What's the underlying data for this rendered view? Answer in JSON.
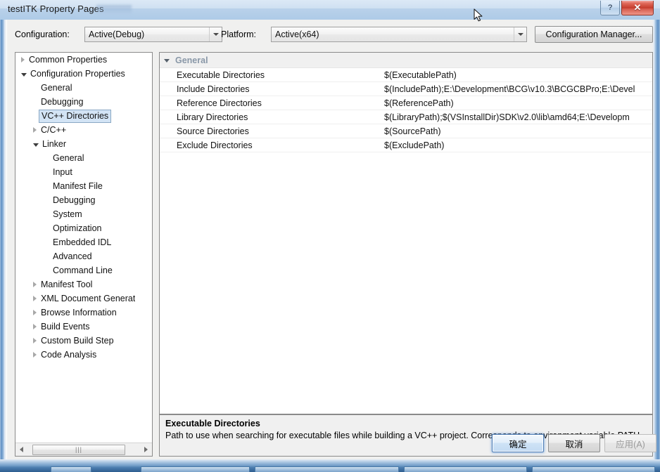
{
  "window": {
    "title": "testITK Property Pages",
    "help_button": "?",
    "close_button": "✕"
  },
  "config_bar": {
    "configuration_label": "Configuration:",
    "configuration_value": "Active(Debug)",
    "platform_label": "Platform:",
    "platform_value": "Active(x64)",
    "configuration_manager_button": "Configuration Manager..."
  },
  "tree": {
    "items": [
      {
        "label": "Common Properties",
        "indent": 0,
        "twisty": "collapsed",
        "selected": false
      },
      {
        "label": "Configuration Properties",
        "indent": 0,
        "twisty": "expanded",
        "selected": false
      },
      {
        "label": "General",
        "indent": 1,
        "twisty": "none",
        "selected": false
      },
      {
        "label": "Debugging",
        "indent": 1,
        "twisty": "none",
        "selected": false
      },
      {
        "label": "VC++ Directories",
        "indent": 1,
        "twisty": "none",
        "selected": true
      },
      {
        "label": "C/C++",
        "indent": 1,
        "twisty": "collapsed",
        "selected": false
      },
      {
        "label": "Linker",
        "indent": 1,
        "twisty": "expanded",
        "selected": false
      },
      {
        "label": "General",
        "indent": 2,
        "twisty": "none",
        "selected": false
      },
      {
        "label": "Input",
        "indent": 2,
        "twisty": "none",
        "selected": false
      },
      {
        "label": "Manifest File",
        "indent": 2,
        "twisty": "none",
        "selected": false
      },
      {
        "label": "Debugging",
        "indent": 2,
        "twisty": "none",
        "selected": false
      },
      {
        "label": "System",
        "indent": 2,
        "twisty": "none",
        "selected": false
      },
      {
        "label": "Optimization",
        "indent": 2,
        "twisty": "none",
        "selected": false
      },
      {
        "label": "Embedded IDL",
        "indent": 2,
        "twisty": "none",
        "selected": false
      },
      {
        "label": "Advanced",
        "indent": 2,
        "twisty": "none",
        "selected": false
      },
      {
        "label": "Command Line",
        "indent": 2,
        "twisty": "none",
        "selected": false
      },
      {
        "label": "Manifest Tool",
        "indent": 1,
        "twisty": "collapsed",
        "selected": false
      },
      {
        "label": "XML Document Generat",
        "indent": 1,
        "twisty": "collapsed",
        "selected": false
      },
      {
        "label": "Browse Information",
        "indent": 1,
        "twisty": "collapsed",
        "selected": false
      },
      {
        "label": "Build Events",
        "indent": 1,
        "twisty": "collapsed",
        "selected": false
      },
      {
        "label": "Custom Build Step",
        "indent": 1,
        "twisty": "collapsed",
        "selected": false
      },
      {
        "label": "Code Analysis",
        "indent": 1,
        "twisty": "collapsed",
        "selected": false
      }
    ],
    "hscroll_grip": "|||"
  },
  "grid": {
    "category": "General",
    "rows": [
      {
        "name": "Executable Directories",
        "value": "$(ExecutablePath)"
      },
      {
        "name": "Include Directories",
        "value": "$(IncludePath);E:\\Development\\BCG\\v10.3\\BCGCBPro;E:\\Devel"
      },
      {
        "name": "Reference Directories",
        "value": "$(ReferencePath)"
      },
      {
        "name": "Library Directories",
        "value": "$(LibraryPath);$(VSInstallDir)SDK\\v2.0\\lib\\amd64;E:\\Developm"
      },
      {
        "name": "Source Directories",
        "value": "$(SourcePath)"
      },
      {
        "name": "Exclude Directories",
        "value": "$(ExcludePath)"
      }
    ]
  },
  "description": {
    "title": "Executable Directories",
    "body": "Path to use when searching for executable files while building a VC++ project.  Corresponds to environment variable PATH."
  },
  "buttons": {
    "ok": "确定",
    "cancel": "取消",
    "apply": "应用(A)"
  },
  "colors": {
    "accent": "#4b7bb5",
    "selection": "#d3e4f5",
    "close": "#c43b2b",
    "category_text": "#8a98a8"
  }
}
